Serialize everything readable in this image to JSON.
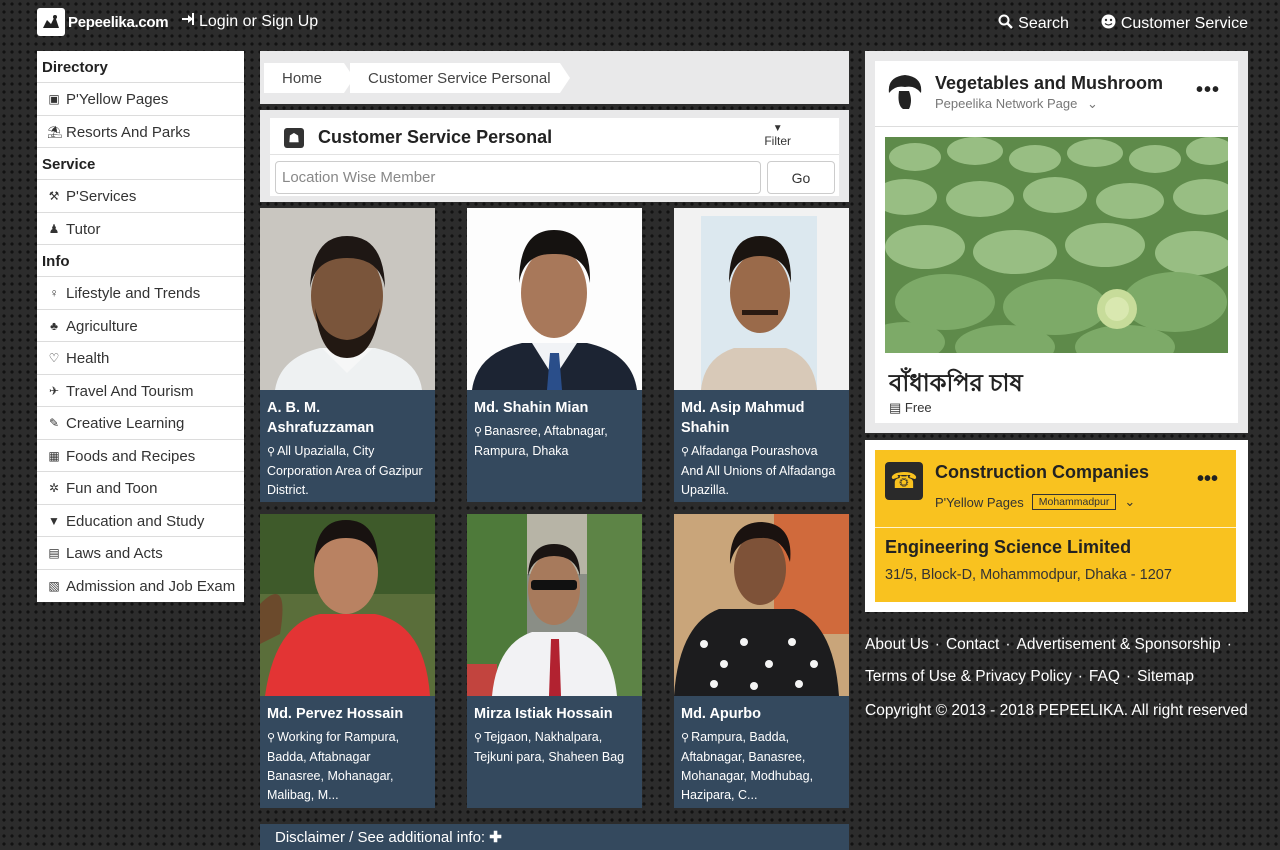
{
  "header": {
    "logo_text": "Pepeelika.com",
    "login_label": "Login or Sign Up",
    "search_label": "Search",
    "customer_service_label": "Customer Service"
  },
  "sidebar": {
    "sections": [
      {
        "title": "Directory",
        "items": [
          {
            "label": "P'Yellow Pages",
            "icon": "book-icon"
          },
          {
            "label": "Resorts And Parks",
            "icon": "resort-icon"
          }
        ]
      },
      {
        "title": "Service",
        "items": [
          {
            "label": "P'Services",
            "icon": "service-icon"
          },
          {
            "label": "Tutor",
            "icon": "tutor-icon"
          }
        ]
      },
      {
        "title": "Info",
        "items": [
          {
            "label": "Lifestyle and Trends",
            "icon": "lifestyle-icon"
          },
          {
            "label": "Agriculture",
            "icon": "agriculture-icon"
          },
          {
            "label": "Health",
            "icon": "health-icon"
          },
          {
            "label": "Travel And Tourism",
            "icon": "travel-icon"
          },
          {
            "label": "Creative Learning",
            "icon": "learning-icon"
          },
          {
            "label": "Foods and Recipes",
            "icon": "food-icon"
          },
          {
            "label": "Fun and Toon",
            "icon": "fun-icon"
          },
          {
            "label": "Education and Study",
            "icon": "graduation-cap-icon"
          },
          {
            "label": "Laws and Acts",
            "icon": "law-icon"
          },
          {
            "label": "Admission and Job Exam",
            "icon": "exam-icon"
          }
        ]
      }
    ]
  },
  "breadcrumb": {
    "home": "Home",
    "current": "Customer Service Personal"
  },
  "search_panel": {
    "title": "Customer Service Personal",
    "filter_label": "Filter",
    "location_placeholder": "Location Wise Member",
    "go_label": "Go"
  },
  "members": [
    {
      "name": "A. B. M. Ashrafuzzaman",
      "location": "All Upazialla, City Corporation Area of Gazipur District."
    },
    {
      "name": "Md. Shahin Mian",
      "location": "Banasree, Aftabnagar, Rampura, Dhaka"
    },
    {
      "name": "Md. Asip Mahmud Shahin",
      "location": "Alfadanga Pourashova And All Unions of Alfadanga Upazilla."
    },
    {
      "name": "Md. Pervez Hossain",
      "location": "Working for Rampura, Badda, Aftabnagar Banasree, Mohanagar, Malibag, M..."
    },
    {
      "name": "Mirza Istiak Hossain",
      "location": "Tejgaon, Nakhalpara, Tejkuni para, Shaheen Bag"
    },
    {
      "name": "Md. Apurbo",
      "location": "Rampura, Badda, Aftabnagar, Banasree, Mohanagar, Modhubag, Hazipara, C..."
    }
  ],
  "disclaimer": {
    "label": "Disclaimer / See additional info:"
  },
  "veg_card": {
    "title": "Vegetables and Mushroom",
    "subtitle": "Pepeelika Network Page",
    "caption": "বাঁধাকপির চাষ",
    "price": "Free"
  },
  "construction_card": {
    "title": "Construction Companies",
    "subtitle": "P'Yellow Pages",
    "tag": "Mohammadpur",
    "company": "Engineering Science Limited",
    "address": "31/5, Block-D, Mohammodpur, Dhaka - 1207"
  },
  "footer": {
    "about": "About Us",
    "contact": "Contact",
    "advertisement": "Advertisement & Sponsorship",
    "terms": "Terms of Use & Privacy Policy",
    "faq": "FAQ",
    "sitemap": "Sitemap",
    "copyright": "Copyright © 2013 - 2018 PEPEELIKA. All right reserved"
  },
  "colors": {
    "card_bg": "#34495e",
    "accent_yellow": "#f9c21f",
    "panel_bg": "#e9e9ea"
  }
}
